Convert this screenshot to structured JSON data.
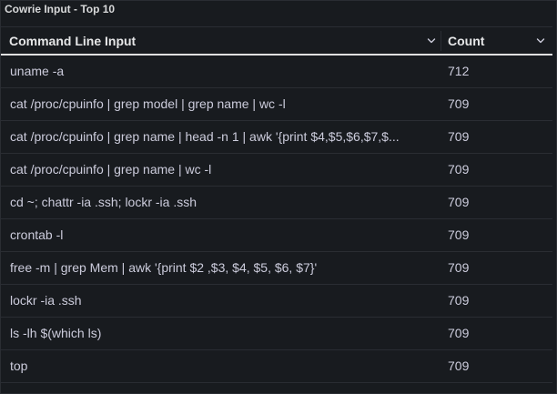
{
  "panel": {
    "title": "Cowrie Input - Top 10"
  },
  "table": {
    "columns": [
      {
        "label": "Command Line Input",
        "icon": "chevron-down-icon"
      },
      {
        "label": "Count",
        "icon": "chevron-down-icon"
      }
    ],
    "rows": [
      {
        "command": "uname -a",
        "count": "712"
      },
      {
        "command": "cat /proc/cpuinfo | grep model | grep name | wc -l",
        "count": "709"
      },
      {
        "command": "cat /proc/cpuinfo | grep name | head -n 1 | awk '{print $4,$5,$6,$7,$...",
        "count": "709"
      },
      {
        "command": "cat /proc/cpuinfo | grep name | wc -l",
        "count": "709"
      },
      {
        "command": "cd ~; chattr -ia .ssh; lockr -ia .ssh",
        "count": "709"
      },
      {
        "command": "crontab -l",
        "count": "709"
      },
      {
        "command": "free -m | grep Mem | awk '{print $2 ,$3, $4, $5, $6, $7}'",
        "count": "709"
      },
      {
        "command": "lockr -ia .ssh",
        "count": "709"
      },
      {
        "command": "ls -lh $(which ls)",
        "count": "709"
      },
      {
        "command": "top",
        "count": "709"
      }
    ]
  },
  "colors": {
    "background": "#181b1f",
    "text": "#ccccdc",
    "header_text": "#e6e7e8",
    "row_border": "#2a2d33",
    "header_underline": "#e0e0e0"
  }
}
